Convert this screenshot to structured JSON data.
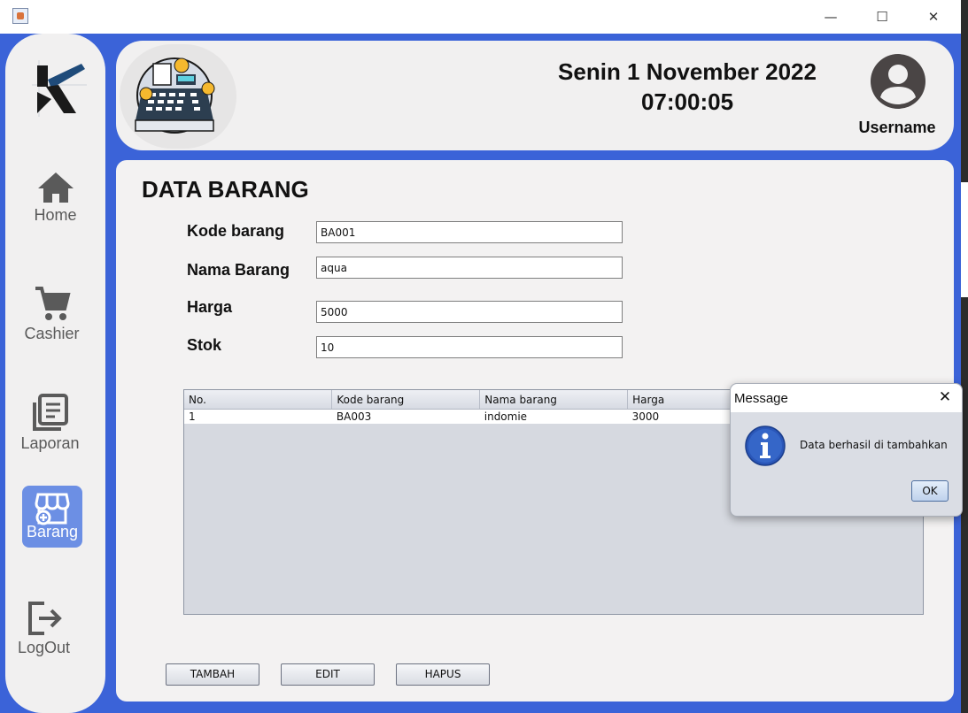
{
  "window": {
    "minimize": "—",
    "maximize": "☐",
    "close": "✕"
  },
  "sidebar": {
    "items": [
      {
        "label": "Home",
        "icon": "home-icon"
      },
      {
        "label": "Cashier",
        "icon": "cart-icon"
      },
      {
        "label": "Laporan",
        "icon": "report-icon"
      },
      {
        "label": "Barang",
        "icon": "store-icon",
        "active": true
      },
      {
        "label": "LogOut",
        "icon": "logout-icon"
      }
    ]
  },
  "header": {
    "date": "Senin 1 November 2022",
    "time": "07:00:05",
    "username": "Username"
  },
  "main": {
    "title": "DATA BARANG",
    "fields": {
      "kode": {
        "label": "Kode barang",
        "value": "BA001"
      },
      "nama": {
        "label": "Nama Barang",
        "value": "aqua"
      },
      "harga": {
        "label": "Harga",
        "value": "5000"
      },
      "stok": {
        "label": "Stok",
        "value": "10"
      }
    },
    "table": {
      "columns": [
        "No.",
        "Kode barang",
        "Nama barang",
        "Harga"
      ],
      "rows": [
        [
          "1",
          "BA003",
          "indomie",
          "3000"
        ]
      ]
    },
    "buttons": {
      "tambah": "TAMBAH",
      "edit": "EDIT",
      "hapus": "HAPUS"
    }
  },
  "dialog": {
    "title": "Message",
    "close": "✕",
    "message": "Data berhasil di tambahkan",
    "ok": "OK"
  },
  "colors": {
    "frame": "#3b63d8",
    "active_nav": "#6c8fe4",
    "panel": "#f1f0f0"
  }
}
